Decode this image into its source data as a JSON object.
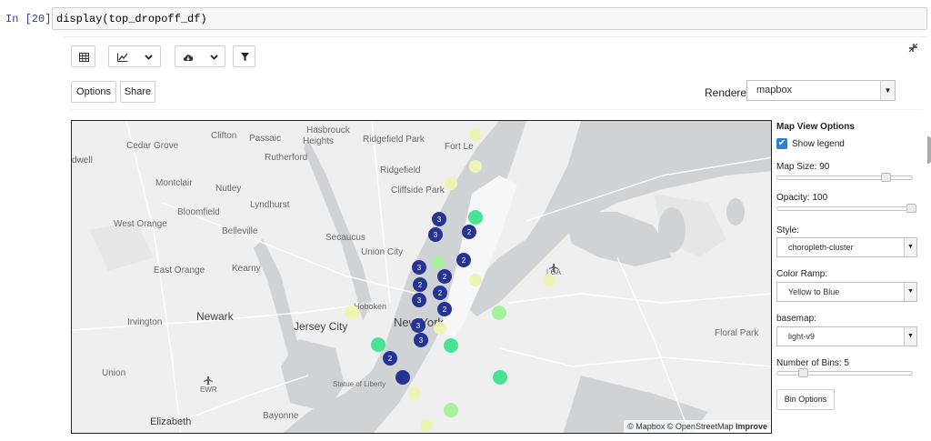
{
  "cell": {
    "prompt": "In [20]:",
    "code": "display(top_dropoff_df)"
  },
  "toolbar": {
    "table_icon": "table-icon",
    "chart_icon": "line-chart-icon",
    "download_icon": "cloud-download-icon",
    "filter_icon": "filter-icon",
    "collapse_icon": "collapse-icon"
  },
  "actions": {
    "options": "Options",
    "share": "Share"
  },
  "renderer": {
    "label": "Renderer:",
    "value": "mapbox"
  },
  "map": {
    "place_labels": [
      "dwell",
      "Cedar Grove",
      "Clifton",
      "Passaic",
      "Hasbrouck",
      "Heights",
      "Ridgefield Park",
      "Fort Le",
      "Rutherford",
      "Montclair",
      "Nutley",
      "Ridgefield",
      "Cliffside Park",
      "Bloomfield",
      "Lyndhurst",
      "West Orange",
      "Belleville",
      "Secaucus",
      "Union City",
      "East Orange",
      "Kearny",
      "LGA",
      "Newark",
      "Hoboken",
      "Jersey City",
      "New York",
      "Irvington",
      "Floral Park",
      "Union",
      "EWR",
      "Statue of Liberty",
      "Elizabeth",
      "Bayonne"
    ],
    "attribution": "© Mapbox © OpenStreetMap",
    "attribution_link": "Improve"
  },
  "clusters": [
    {
      "count": "3"
    },
    {
      "count": "3"
    },
    {
      "count": "2"
    },
    {
      "count": "2"
    },
    {
      "count": "3"
    },
    {
      "count": "2"
    },
    {
      "count": "2"
    },
    {
      "count": "3"
    },
    {
      "count": "2"
    },
    {
      "count": "2"
    },
    {
      "count": "3"
    },
    {
      "count": "3"
    },
    {
      "count": "2"
    }
  ],
  "colors": {
    "yellow": "#eef5b4",
    "green": "#a4f29a",
    "teal": "#48e493",
    "blue": "#253494",
    "checkbox": "#2980d9"
  },
  "panel": {
    "title": "Map View Options",
    "show_legend": "Show legend",
    "show_legend_checked": true,
    "map_size": "Map Size: 90",
    "map_size_value": 90,
    "opacity": "Opacity: 100",
    "opacity_value": 100,
    "style_label": "Style:",
    "style_value": "choropleth-cluster",
    "color_ramp_label": "Color Ramp:",
    "color_ramp_value": "Yellow to Blue",
    "basemap_label": "basemap:",
    "basemap_value": "light-v9",
    "bins_label": "Number of Bins: 5",
    "bins_value": 5,
    "bin_options": "Bin Options"
  }
}
